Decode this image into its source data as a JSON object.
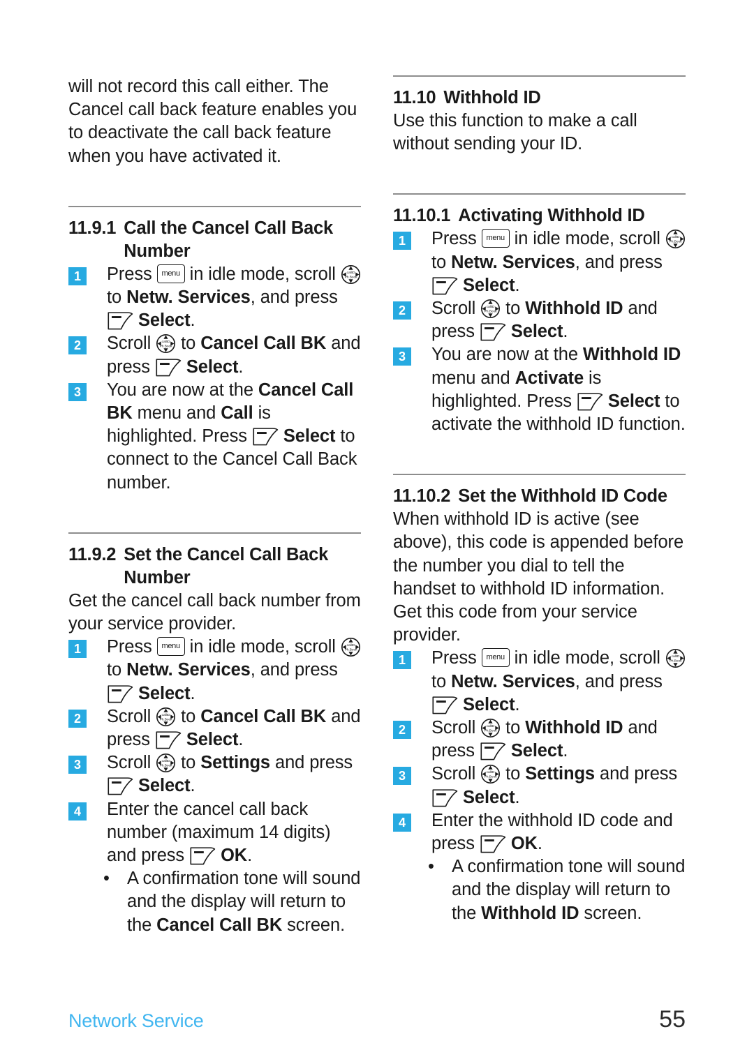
{
  "footer": {
    "chapter_label": "Network Service",
    "page_number": "55",
    "label_color": "#41b6f0"
  },
  "icons": {
    "menu": "menu-key-icon",
    "menu_text": "menu",
    "scroll": "scroll-navigation-icon",
    "scroll_top_text": "callID",
    "scroll_bottom_text": "Ph.Book",
    "softkey": "soft-key-icon"
  },
  "accent_color": "#27aae1",
  "left_column": {
    "intro_paragraph": "will not record this call either. The Cancel call back feature enables you to deactivate the call back feature when you have activated it.",
    "section_1": {
      "number": "11.9.1",
      "title_line1": "Call the Cancel Call Back",
      "title_line2": "Number",
      "steps": [
        {
          "badge": "1",
          "parts": [
            {
              "t": "text",
              "v": "Press "
            },
            {
              "t": "icon",
              "v": "menu"
            },
            {
              "t": "text",
              "v": " in idle mode, scroll "
            },
            {
              "t": "icon",
              "v": "scroll"
            },
            {
              "t": "text",
              "v": " to "
            },
            {
              "t": "bold",
              "v": "Netw. Services"
            },
            {
              "t": "text",
              "v": ", and press "
            },
            {
              "t": "icon",
              "v": "softkey"
            },
            {
              "t": "bold",
              "v": " Select"
            },
            {
              "t": "text",
              "v": "."
            }
          ]
        },
        {
          "badge": "2",
          "parts": [
            {
              "t": "text",
              "v": "Scroll "
            },
            {
              "t": "icon",
              "v": "scroll"
            },
            {
              "t": "text",
              "v": " to "
            },
            {
              "t": "bold",
              "v": "Cancel Call BK"
            },
            {
              "t": "text",
              "v": " and press "
            },
            {
              "t": "icon",
              "v": "softkey"
            },
            {
              "t": "bold",
              "v": " Select"
            },
            {
              "t": "text",
              "v": "."
            }
          ]
        },
        {
          "badge": "3",
          "parts": [
            {
              "t": "text",
              "v": "You are now at the "
            },
            {
              "t": "bold",
              "v": "Cancel Call BK"
            },
            {
              "t": "text",
              "v": " menu and "
            },
            {
              "t": "bold",
              "v": "Call"
            },
            {
              "t": "text",
              "v": " is highlighted. Press "
            },
            {
              "t": "icon",
              "v": "softkey"
            },
            {
              "t": "bold",
              "v": " Select"
            },
            {
              "t": "text",
              "v": " to connect to the Cancel Call Back number."
            }
          ]
        }
      ]
    },
    "section_2": {
      "number": "11.9.2",
      "title_line1": "Set the Cancel Call Back",
      "title_line2": "Number",
      "intro": "Get the cancel call back number from your service provider.",
      "steps": [
        {
          "badge": "1",
          "parts": [
            {
              "t": "text",
              "v": "Press "
            },
            {
              "t": "icon",
              "v": "menu"
            },
            {
              "t": "text",
              "v": " in idle mode, scroll "
            },
            {
              "t": "icon",
              "v": "scroll"
            },
            {
              "t": "text",
              "v": " to "
            },
            {
              "t": "bold",
              "v": "Netw. Services"
            },
            {
              "t": "text",
              "v": ", and press "
            },
            {
              "t": "icon",
              "v": "softkey"
            },
            {
              "t": "bold",
              "v": " Select"
            },
            {
              "t": "text",
              "v": "."
            }
          ]
        },
        {
          "badge": "2",
          "parts": [
            {
              "t": "text",
              "v": "Scroll "
            },
            {
              "t": "icon",
              "v": "scroll"
            },
            {
              "t": "text",
              "v": " to "
            },
            {
              "t": "bold",
              "v": "Cancel Call BK"
            },
            {
              "t": "text",
              "v": " and press "
            },
            {
              "t": "icon",
              "v": "softkey"
            },
            {
              "t": "bold",
              "v": " Select"
            },
            {
              "t": "text",
              "v": "."
            }
          ]
        },
        {
          "badge": "3",
          "parts": [
            {
              "t": "text",
              "v": "Scroll "
            },
            {
              "t": "icon",
              "v": "scroll"
            },
            {
              "t": "text",
              "v": " to "
            },
            {
              "t": "bold",
              "v": "Settings"
            },
            {
              "t": "text",
              "v": " and press "
            },
            {
              "t": "icon",
              "v": "softkey"
            },
            {
              "t": "bold",
              "v": " Select"
            },
            {
              "t": "text",
              "v": "."
            }
          ]
        },
        {
          "badge": "4",
          "parts": [
            {
              "t": "text",
              "v": "Enter the cancel call back number (maximum 14 digits) and press "
            },
            {
              "t": "icon",
              "v": "softkey"
            },
            {
              "t": "bold",
              "v": " OK"
            },
            {
              "t": "text",
              "v": "."
            }
          ]
        }
      ],
      "bullets": [
        {
          "marker": "•",
          "parts": [
            {
              "t": "text",
              "v": "A confirmation tone will sound and the display will return to the "
            },
            {
              "t": "bold",
              "v": "Cancel Call BK"
            },
            {
              "t": "text",
              "v": " screen."
            }
          ]
        }
      ]
    }
  },
  "right_column": {
    "section_1": {
      "number": "11.10",
      "title": "Withhold ID",
      "intro": "Use this function to make a call without sending your ID."
    },
    "section_2": {
      "number": "11.10.1",
      "title": "Activating Withhold ID",
      "steps": [
        {
          "badge": "1",
          "parts": [
            {
              "t": "text",
              "v": "Press "
            },
            {
              "t": "icon",
              "v": "menu"
            },
            {
              "t": "text",
              "v": " in idle mode, scroll "
            },
            {
              "t": "icon",
              "v": "scroll"
            },
            {
              "t": "text",
              "v": " to "
            },
            {
              "t": "bold",
              "v": "Netw. Services"
            },
            {
              "t": "text",
              "v": ", and press "
            },
            {
              "t": "icon",
              "v": "softkey"
            },
            {
              "t": "bold",
              "v": " Select"
            },
            {
              "t": "text",
              "v": "."
            }
          ]
        },
        {
          "badge": "2",
          "parts": [
            {
              "t": "text",
              "v": "Scroll "
            },
            {
              "t": "icon",
              "v": "scroll"
            },
            {
              "t": "text",
              "v": " to "
            },
            {
              "t": "bold",
              "v": "Withhold ID"
            },
            {
              "t": "text",
              "v": " and press "
            },
            {
              "t": "icon",
              "v": "softkey"
            },
            {
              "t": "bold",
              "v": " Select"
            },
            {
              "t": "text",
              "v": "."
            }
          ]
        },
        {
          "badge": "3",
          "parts": [
            {
              "t": "text",
              "v": "You are now at the "
            },
            {
              "t": "bold",
              "v": "Withhold ID"
            },
            {
              "t": "text",
              "v": " menu and "
            },
            {
              "t": "bold",
              "v": "Activate"
            },
            {
              "t": "text",
              "v": " is highlighted. Press "
            },
            {
              "t": "icon",
              "v": "softkey"
            },
            {
              "t": "bold",
              "v": " Select"
            },
            {
              "t": "text",
              "v": " to activate the withhold ID function."
            }
          ]
        }
      ]
    },
    "section_3": {
      "number": "11.10.2",
      "title": "Set the Withhold ID Code",
      "intro": "When withhold ID is active (see above), this code is appended before the number you dial to tell the handset to withhold ID information. Get this code from your service provider.",
      "steps": [
        {
          "badge": "1",
          "parts": [
            {
              "t": "text",
              "v": "Press "
            },
            {
              "t": "icon",
              "v": "menu"
            },
            {
              "t": "text",
              "v": " in idle mode, scroll "
            },
            {
              "t": "icon",
              "v": "scroll"
            },
            {
              "t": "text",
              "v": " to "
            },
            {
              "t": "bold",
              "v": "Netw. Services"
            },
            {
              "t": "text",
              "v": ", and press "
            },
            {
              "t": "icon",
              "v": "softkey"
            },
            {
              "t": "bold",
              "v": " Select"
            },
            {
              "t": "text",
              "v": "."
            }
          ]
        },
        {
          "badge": "2",
          "parts": [
            {
              "t": "text",
              "v": "Scroll "
            },
            {
              "t": "icon",
              "v": "scroll"
            },
            {
              "t": "text",
              "v": " to "
            },
            {
              "t": "bold",
              "v": "Withhold ID"
            },
            {
              "t": "text",
              "v": " and press "
            },
            {
              "t": "icon",
              "v": "softkey"
            },
            {
              "t": "bold",
              "v": " Select"
            },
            {
              "t": "text",
              "v": "."
            }
          ]
        },
        {
          "badge": "3",
          "parts": [
            {
              "t": "text",
              "v": "Scroll "
            },
            {
              "t": "icon",
              "v": "scroll"
            },
            {
              "t": "text",
              "v": " to "
            },
            {
              "t": "bold",
              "v": "Settings"
            },
            {
              "t": "text",
              "v": " and press "
            },
            {
              "t": "icon",
              "v": "softkey"
            },
            {
              "t": "bold",
              "v": " Select"
            },
            {
              "t": "text",
              "v": "."
            }
          ]
        },
        {
          "badge": "4",
          "parts": [
            {
              "t": "text",
              "v": "Enter the withhold ID code and press "
            },
            {
              "t": "icon",
              "v": "softkey"
            },
            {
              "t": "bold",
              "v": " OK"
            },
            {
              "t": "text",
              "v": "."
            }
          ]
        }
      ],
      "bullets": [
        {
          "marker": "•",
          "parts": [
            {
              "t": "text",
              "v": "A confirmation tone will sound and the display will return to the "
            },
            {
              "t": "bold",
              "v": "Withhold ID"
            },
            {
              "t": "text",
              "v": " screen."
            }
          ]
        }
      ]
    }
  }
}
